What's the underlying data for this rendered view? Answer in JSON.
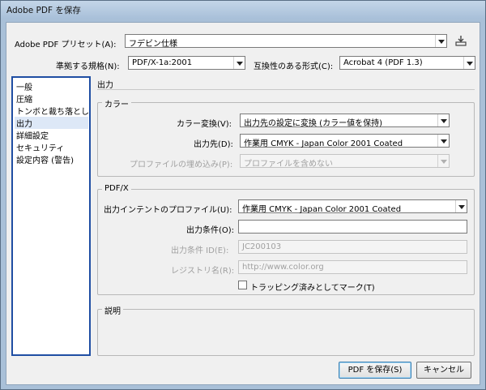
{
  "window": {
    "title": "Adobe PDF を保存"
  },
  "preset": {
    "label": "Adobe PDF プリセット(A):",
    "value": "フデビン仕様",
    "save_icon": "save-preset-icon"
  },
  "standard": {
    "label": "準拠する規格(N):",
    "value": "PDF/X-1a:2001"
  },
  "compat": {
    "label": "互換性のある形式(C):",
    "value": "Acrobat 4 (PDF 1.3)"
  },
  "sidebar": {
    "items": [
      {
        "label": "一般"
      },
      {
        "label": "圧縮"
      },
      {
        "label": "トンボと裁ち落とし"
      },
      {
        "label": "出力",
        "selected": true
      },
      {
        "label": "詳細設定"
      },
      {
        "label": "セキュリティ"
      },
      {
        "label": "設定内容 (警告)"
      }
    ]
  },
  "section": {
    "title": "出力"
  },
  "color": {
    "title": "カラー",
    "conversion": {
      "label": "カラー変換(V):",
      "value": "出力先の設定に変換 (カラー値を保持)"
    },
    "destination": {
      "label": "出力先(D):",
      "value": "作業用 CMYK - Japan Color 2001 Coated"
    },
    "profile_inclusion": {
      "label": "プロファイルの埋め込み(P):",
      "value": "プロファイルを含めない"
    }
  },
  "pdfx": {
    "title": "PDF/X",
    "intent_profile": {
      "label": "出力インテントのプロファイル(U):",
      "value": "作業用 CMYK - Japan Color 2001 Coated"
    },
    "condition": {
      "label": "出力条件(O):",
      "value": ""
    },
    "condition_id": {
      "label": "出力条件 ID(E):",
      "value": "JC200103"
    },
    "registry": {
      "label": "レジストリ名(R):",
      "value": "http://www.color.org"
    },
    "trapped": {
      "label": "トラッピング済みとしてマーク(T)",
      "checked": false
    }
  },
  "description": {
    "title": "説明"
  },
  "buttons": {
    "save": "PDF を保存(S)",
    "cancel": "キャンセル"
  }
}
